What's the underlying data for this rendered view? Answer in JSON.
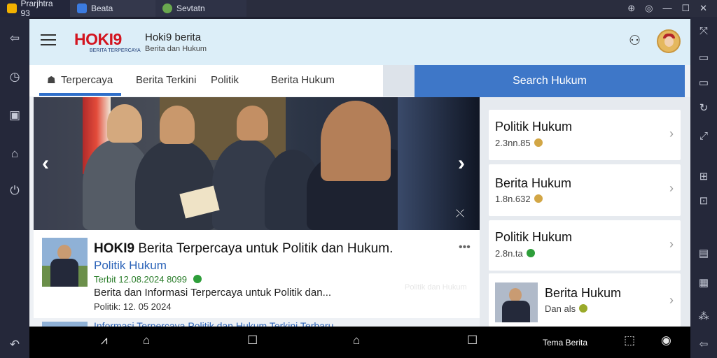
{
  "window": {
    "tabs": [
      {
        "label": "Prarjhtra 93",
        "icon": "bluestacks-icon",
        "color": "#f2b100"
      },
      {
        "label": "Beata",
        "icon": "home-icon",
        "color": "#3b7be0"
      },
      {
        "label": "Sevtatn",
        "icon": "globe-icon",
        "color": "#6aa84f"
      }
    ],
    "controls": [
      "help-icon",
      "settings-icon",
      "minimize-icon",
      "maximize-icon",
      "close-icon"
    ]
  },
  "left_toolbar": [
    "back-icon",
    "clock-icon",
    "screenshot-icon",
    "home-icon",
    "power-icon",
    "undo-icon"
  ],
  "right_toolbar": [
    "resize-icon",
    "keyboard-icon",
    "volume-icon",
    "rotate-icon",
    "shake-icon",
    "gamepad-icon",
    "location-icon",
    "layout-icon",
    "macro-icon",
    "back-icon"
  ],
  "app": {
    "logo": "HOKI9",
    "logo_sub": "BERITA TERPERCAYA",
    "brand_title": "Hoki9 berita",
    "brand_sub": "Berita dan Hukum",
    "colors": {
      "accent": "#2f6fca",
      "logo": "#d3141f",
      "search": "#3e77c8"
    }
  },
  "nav": {
    "tabs": [
      "Terpercaya",
      "Berita Terkini",
      "Politik",
      "Berita Hukum"
    ],
    "active": 0,
    "search_label": "Search Hukum"
  },
  "carousel": {
    "prev": "‹",
    "next": "›"
  },
  "article": {
    "title_brand": "HOKI9",
    "title_rest": "Berita Terpercaya untuk Politik dan Hukum.",
    "category": "Politik Hukum",
    "meta": "Terbit 12.08.2024 8099",
    "desc": "Berita dan Informasi Terpercaya untuk Politik dan...",
    "date": "Politik: 12. 05 2024",
    "ghost": "Politik dan Hukum",
    "next_title": "Informasi Terpercaya Politik dan Hukum Terkini Terbaru"
  },
  "sidebar": [
    {
      "title": "Politik Hukum",
      "meta": "2.3nn.85",
      "dot": "#d2a645"
    },
    {
      "title": "Berita Hukum",
      "meta": "1.8n.632",
      "dot": "#d2a645"
    },
    {
      "title": "Politik Hukum",
      "meta": "2.8n.ta",
      "dot": "#2e9e3a"
    },
    {
      "title": "Berita Hukum",
      "meta": "Dan als",
      "dot": "#9aaa2a"
    }
  ],
  "navbar": {
    "label": "Tema Berita",
    "icons": [
      "network-icon",
      "home-outline-icon",
      "square-icon",
      "home-icon",
      "recents-icon",
      "expand-icon",
      "camera-icon"
    ]
  }
}
